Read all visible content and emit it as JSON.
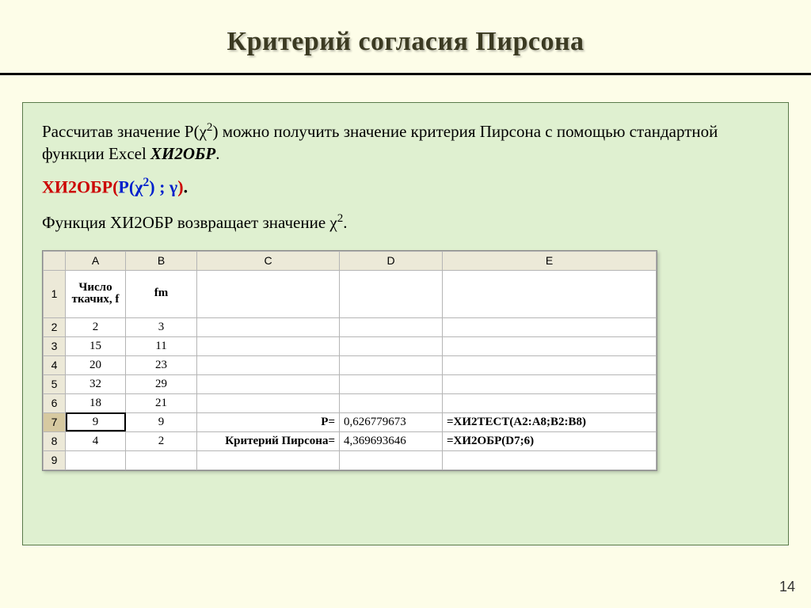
{
  "title": "Критерий согласия Пирсона",
  "para1_a": "Рассчитав значение P(",
  "para1_chi": "χ",
  "para1_sup": "2",
  "para1_b": ") можно получить значение критерия Пирсона с помощью стандартной функции Excel ",
  "para1_func": "ХИ2ОБР",
  "para1_c": ".",
  "formula": {
    "f1": "ХИ2ОБР(",
    "p_open": "P(",
    "chi": "χ",
    "sup": "2",
    "p_close": ")",
    "sep": " ; γ",
    "close": ")",
    "dot": "."
  },
  "para2_a": "Функция ХИ2ОБР возвращает значение ",
  "para2_chi": "χ",
  "para2_sup": "2",
  "para2_b": ".",
  "columns": [
    "A",
    "B",
    "C",
    "D",
    "E"
  ],
  "rowheaders": [
    "1",
    "2",
    "3",
    "4",
    "5",
    "6",
    "7",
    "8",
    "9"
  ],
  "table": {
    "header_a": "Число ткачих, f",
    "header_b": "fm",
    "row2": {
      "a": "2",
      "b": "3"
    },
    "row3": {
      "a": "15",
      "b": "11"
    },
    "row4": {
      "a": "20",
      "b": "23"
    },
    "row5": {
      "a": "32",
      "b": "29"
    },
    "row6": {
      "a": "18",
      "b": "21"
    },
    "row7": {
      "a": "9",
      "b": "9",
      "c": "P=",
      "d": "0,626779673",
      "e": "=ХИ2ТЕСТ(A2:A8;B2:B8)"
    },
    "row8": {
      "a": "4",
      "b": "2",
      "c": "Критерий Пирсона=",
      "d": "4,369693646",
      "e": "=ХИ2ОБР(D7;6)"
    }
  },
  "page_number": "14"
}
